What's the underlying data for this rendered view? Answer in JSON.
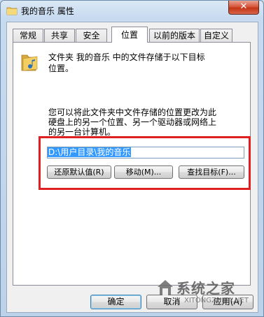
{
  "window": {
    "title": "我的音乐 属性",
    "close_glyph": "✕"
  },
  "tabs": [
    {
      "label": "常规"
    },
    {
      "label": "共享"
    },
    {
      "label": "安全"
    },
    {
      "label": "位置"
    },
    {
      "label": "以前的版本"
    },
    {
      "label": "自定义"
    }
  ],
  "active_tab": "位置",
  "location": {
    "description": "文件夹 我的音乐 中的文件存储于以下目标位置。",
    "explanation": "您可以将此文件夹中文件存储的位置更改为此硬盘上的另一个位置、另一个驱动器或网络上的另一台计算机。",
    "path_value": "D:\\用户目录\\我的音乐",
    "restore_label": "还原默认值(R)",
    "move_label": "移动(M)...",
    "find_label": "查找目标(F)..."
  },
  "footer": {
    "ok_label": "确定",
    "cancel_label": "取消",
    "apply_label": "应用(A)"
  },
  "watermark": {
    "text": "系统之家",
    "url": "XITONGZHIJIA.NET"
  },
  "colors": {
    "highlight_box": "#e02020",
    "selection": "#3399ff"
  }
}
